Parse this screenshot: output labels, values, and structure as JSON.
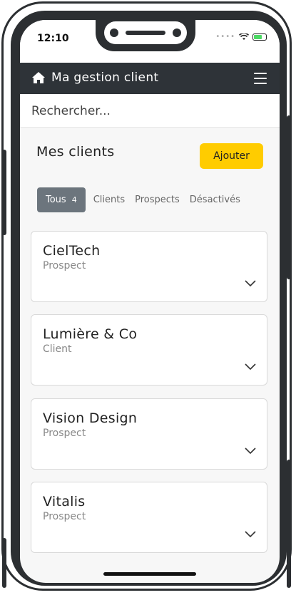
{
  "status_bar": {
    "time": "12:10",
    "signal_text": "••••"
  },
  "header": {
    "title": "Ma gestion client",
    "home_icon": "home-icon",
    "menu_icon": "hamburger-menu-icon"
  },
  "search": {
    "placeholder": "Rechercher..."
  },
  "section": {
    "title": "Mes clients",
    "add_label": "Ajouter"
  },
  "tabs": [
    {
      "label": "Tous",
      "count": "4",
      "active": true
    },
    {
      "label": "Clients",
      "active": false
    },
    {
      "label": "Prospects",
      "active": false
    },
    {
      "label": "Désactivés",
      "active": false
    }
  ],
  "clients": [
    {
      "name": "CielTech",
      "type": "Prospect"
    },
    {
      "name": "Lumière & Co",
      "type": "Client"
    },
    {
      "name": "Vision Design",
      "type": "Prospect"
    },
    {
      "name": "Vitalis",
      "type": "Prospect"
    }
  ],
  "colors": {
    "header_bg": "#2e3338",
    "accent_button": "#ffcc00",
    "active_tab": "#6c757d",
    "frame": "#2c2f32"
  }
}
